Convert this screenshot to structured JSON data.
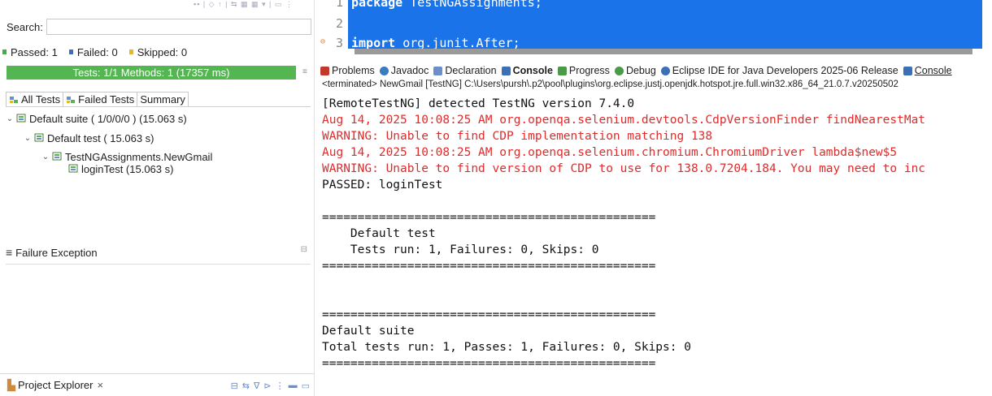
{
  "left": {
    "search_label": "Search:",
    "search_value": "",
    "counters": [
      {
        "label": "Passed: 1",
        "kind": "pass"
      },
      {
        "label": "Failed: 0",
        "kind": "fail"
      },
      {
        "label": "Skipped: 0",
        "kind": "skip"
      }
    ],
    "progress_text": "Tests: 1/1  Methods: 1 (17357 ms)",
    "progress_color": "#54b650",
    "tabs": [
      "All Tests",
      "Failed Tests",
      "Summary"
    ],
    "tree": [
      {
        "label": "Default suite ( 1/0/0/0 ) (15.063 s)",
        "level": 0,
        "expanded": true
      },
      {
        "label": "Default test ( 15.063 s)",
        "level": 1,
        "expanded": true
      },
      {
        "label": "TestNGAssignments.NewGmail",
        "level": 2,
        "expanded": true
      },
      {
        "label": "loginTest  (15.063 s)",
        "level": 3,
        "expanded": false
      }
    ],
    "failure_title": "Failure Exception",
    "project_explorer": "Project Explorer",
    "close_glyph": "×"
  },
  "editor": {
    "lines": [
      {
        "num": "1",
        "keyword": "package",
        "rest": " TestNGAssignments;"
      },
      {
        "num": "2",
        "keyword": "",
        "rest": ""
      },
      {
        "num": "3",
        "keyword": "import",
        "rest": " org.junit.After;"
      }
    ]
  },
  "views": {
    "tabs": [
      {
        "label": "Problems",
        "icon": "problems-icon",
        "bold": false,
        "color": "#c0392b"
      },
      {
        "label": "Javadoc",
        "icon": "javadoc-icon",
        "bold": false,
        "color": "#3b7bbf"
      },
      {
        "label": "Declaration",
        "icon": "declaration-icon",
        "bold": false,
        "color": "#6a8fc9"
      },
      {
        "label": "Console",
        "icon": "console-icon",
        "bold": true,
        "color": "#3b6fb6"
      },
      {
        "label": "Progress",
        "icon": "progress-icon",
        "bold": false,
        "color": "#4a9a4a"
      },
      {
        "label": "Debug",
        "icon": "debug-icon",
        "bold": false,
        "color": "#4a9a4a"
      },
      {
        "label": "Eclipse IDE for Java Developers 2025-06 Release",
        "icon": "info-icon",
        "bold": false,
        "color": "#3b6fb6"
      },
      {
        "label": "Console",
        "icon": "console-icon",
        "bold": false,
        "color": "#3b6fb6"
      }
    ],
    "terminated": "<terminated> NewGmail [TestNG] C:\\Users\\pursh\\.p2\\pool\\plugins\\org.eclipse.justj.openjdk.hotspot.jre.full.win32.x86_64_21.0.7.v20250502"
  },
  "console": {
    "lines": [
      {
        "text": "[RemoteTestNG] detected TestNG version 7.4.0",
        "color": "black"
      },
      {
        "text": "Aug 14, 2025 10:08:25 AM org.openqa.selenium.devtools.CdpVersionFinder findNearestMat",
        "color": "red"
      },
      {
        "text": "WARNING: Unable to find CDP implementation matching 138",
        "color": "red"
      },
      {
        "text": "Aug 14, 2025 10:08:25 AM org.openqa.selenium.chromium.ChromiumDriver lambda$new$5",
        "color": "red"
      },
      {
        "text": "WARNING: Unable to find version of CDP to use for 138.0.7204.184. You may need to inc",
        "color": "red"
      },
      {
        "text": "PASSED: loginTest",
        "color": "black"
      },
      {
        "text": "",
        "color": "black"
      },
      {
        "text": "===============================================",
        "color": "black"
      },
      {
        "text": "    Default test",
        "color": "black"
      },
      {
        "text": "    Tests run: 1, Failures: 0, Skips: 0",
        "color": "black"
      },
      {
        "text": "===============================================",
        "color": "black"
      },
      {
        "text": "",
        "color": "black"
      },
      {
        "text": "",
        "color": "black"
      },
      {
        "text": "===============================================",
        "color": "black"
      },
      {
        "text": "Default suite",
        "color": "black"
      },
      {
        "text": "Total tests run: 1, Passes: 1, Failures: 0, Skips: 0",
        "color": "black"
      },
      {
        "text": "===============================================",
        "color": "black"
      }
    ]
  }
}
